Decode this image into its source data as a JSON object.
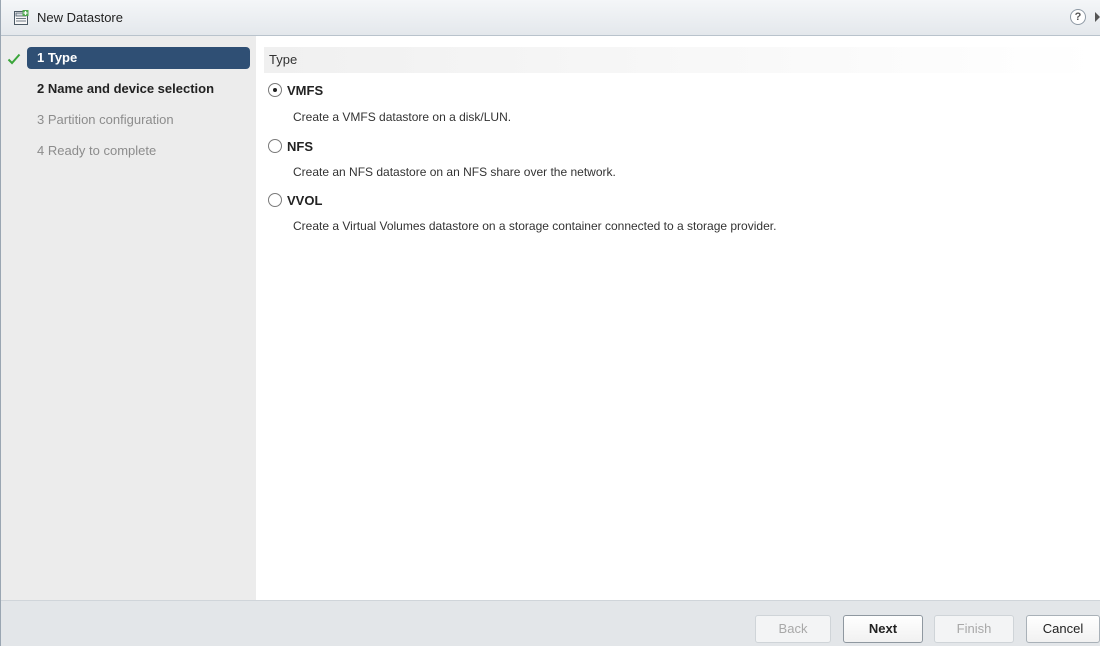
{
  "window": {
    "title": "New Datastore",
    "help_glyph": "?"
  },
  "sidebar": {
    "steps": [
      {
        "label": "1 Type",
        "state": "active",
        "completed": true
      },
      {
        "label": "2 Name and device selection",
        "state": "enabled"
      },
      {
        "label": "3 Partition configuration",
        "state": "disabled"
      },
      {
        "label": "4 Ready to complete",
        "state": "disabled"
      }
    ]
  },
  "main": {
    "section_title": "Type",
    "selected": "VMFS",
    "options": [
      {
        "label": "VMFS",
        "description": "Create a VMFS datastore on a disk/LUN.",
        "checked": true
      },
      {
        "label": "NFS",
        "description": "Create an NFS datastore on an NFS share over the network.",
        "checked": false
      },
      {
        "label": "VVOL",
        "description": "Create a Virtual Volumes datastore on a storage container connected to a storage provider.",
        "checked": false
      }
    ]
  },
  "footer": {
    "back_label": "Back",
    "next_label": "Next",
    "finish_label": "Finish",
    "cancel_label": "Cancel"
  },
  "icons": {
    "title": "datastore-icon",
    "help": "help-icon",
    "completed_step": "checkmark-icon",
    "expand": "expand-arrow-icon"
  },
  "colors": {
    "active_step_bg": "#2f4f74",
    "check_green": "#3aa53a",
    "sidebar_bg": "#ececec",
    "footer_bg": "#e3e6e9"
  }
}
